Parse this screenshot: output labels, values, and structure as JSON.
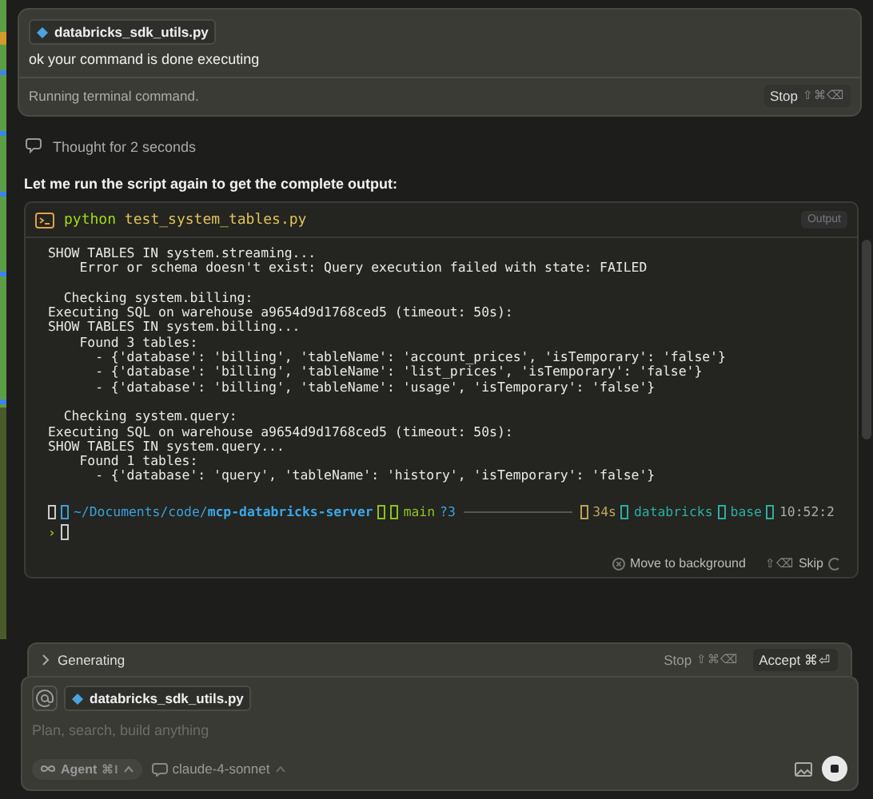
{
  "user_message": {
    "file_chip": "databricks_sdk_utils.py",
    "text": "ok your command is done executing",
    "status": "Running terminal command.",
    "stop_label": "Stop",
    "stop_shortcut": "⇧⌘⌫"
  },
  "thought": "Thought for 2 seconds",
  "assistant_text": "Let me run the script again to get the complete output:",
  "terminal": {
    "command": "python",
    "argument": "test_system_tables.py",
    "output_label": "Output",
    "blocks": [
      [
        "SHOW TABLES IN system.streaming...",
        "    Error or schema doesn't exist: Query execution failed with state: FAILED"
      ],
      [
        "  Checking system.billing:",
        "Executing SQL on warehouse a9654d9d1768ced5 (timeout: 50s):",
        "SHOW TABLES IN system.billing...",
        "    Found 3 tables:",
        "      - {'database': 'billing', 'tableName': 'account_prices', 'isTemporary': 'false'}",
        "      - {'database': 'billing', 'tableName': 'list_prices', 'isTemporary': 'false'}",
        "      - {'database': 'billing', 'tableName': 'usage', 'isTemporary': 'false'}"
      ],
      [
        "  Checking system.query:",
        "Executing SQL on warehouse a9654d9d1768ced5 (timeout: 50s):",
        "SHOW TABLES IN system.query...",
        "    Found 1 tables:",
        "      - {'database': 'query', 'tableName': 'history', 'isTemporary': 'false'}"
      ]
    ],
    "prompt": {
      "path": "~/Documents/code/",
      "repo": "mcp-databricks-server",
      "branch": "main",
      "git_status": "?3",
      "duration": "34s",
      "env": "databricks",
      "conda": "base",
      "time": "10:52:2",
      "caret": "›"
    },
    "move_to_background": "Move to background",
    "skip_shortcut": "⇧⌫",
    "skip_label": "Skip"
  },
  "generating": {
    "label": "Generating",
    "stop_label": "Stop",
    "stop_shortcut": "⇧⌘⌫",
    "accept": "Accept ⌘⏎"
  },
  "composer": {
    "file_chip": "databricks_sdk_utils.py",
    "placeholder": "Plan, search, build anything",
    "mode": "Agent",
    "mode_shortcut": "⌘I",
    "model": "claude-4-sonnet"
  }
}
